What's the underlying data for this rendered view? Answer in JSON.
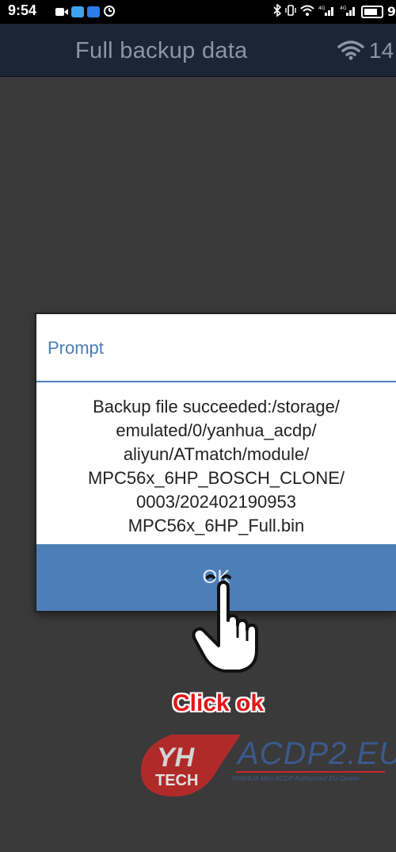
{
  "status_bar": {
    "time": "9:54",
    "network_label": "4G",
    "battery_label": "9"
  },
  "app_header": {
    "title": "Full backup data",
    "signal_value": "14"
  },
  "dialog": {
    "title": "Prompt",
    "message": "Backup file succeeded:/storage/\nemulated/0/yanhua_acdp/\naliyun/ATmatch/module/\nMPC56x_6HP_BOSCH_CLONE/\n0003/202402190953\nMPC56x_6HP_Full.bin",
    "ok_label": "OK"
  },
  "annotation": {
    "caption": "Click ok"
  },
  "watermark": {
    "logo_text": "TECH",
    "brand": "ACDP2.EU",
    "tagline": "YANHUA Mini ACDP Authorized EU Dealer"
  },
  "colors": {
    "dialog_accent": "#4d7eb8",
    "caption": "#e01818",
    "app_header": "#1a2535"
  }
}
